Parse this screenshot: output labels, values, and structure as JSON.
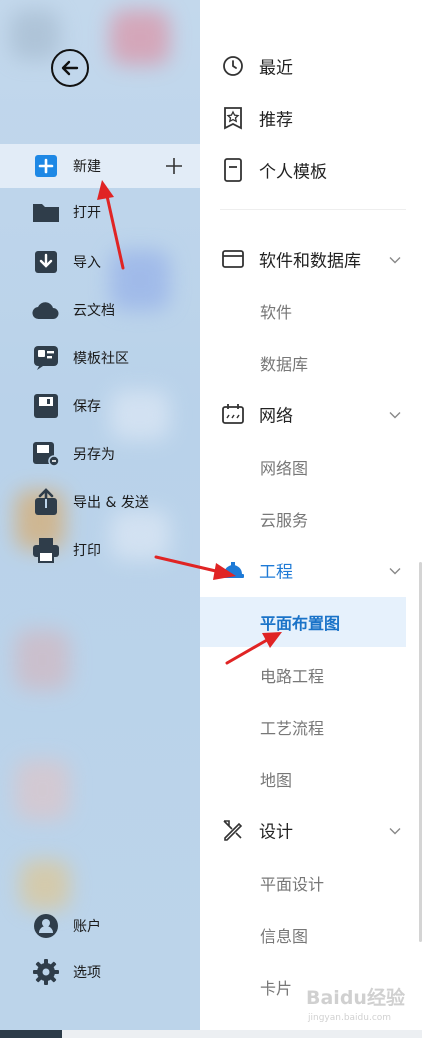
{
  "left_menu": {
    "back_label": "",
    "items": [
      {
        "id": "new",
        "label": "新建",
        "active": true
      },
      {
        "id": "open",
        "label": "打开"
      },
      {
        "id": "import",
        "label": "导入"
      },
      {
        "id": "cloud",
        "label": "云文档"
      },
      {
        "id": "templates",
        "label": "模板社区"
      },
      {
        "id": "save",
        "label": "保存"
      },
      {
        "id": "save_as",
        "label": "另存为"
      },
      {
        "id": "export",
        "label": "导出 & 发送"
      },
      {
        "id": "print",
        "label": "打印"
      }
    ],
    "bottom_items": [
      {
        "id": "account",
        "label": "账户"
      },
      {
        "id": "options",
        "label": "选项"
      }
    ]
  },
  "right_menu": {
    "top_items": [
      {
        "id": "recent",
        "label": "最近",
        "icon": "clock-icon"
      },
      {
        "id": "recommend",
        "label": "推荐",
        "icon": "star-badge-icon"
      },
      {
        "id": "personal",
        "label": "个人模板",
        "icon": "document-icon"
      }
    ],
    "categories": [
      {
        "id": "software",
        "label": "软件和数据库",
        "icon": "window-icon",
        "expanded": true,
        "subitems": [
          "软件",
          "数据库"
        ]
      },
      {
        "id": "network",
        "label": "网络",
        "icon": "network-icon",
        "expanded": true,
        "subitems": [
          "网络图",
          "云服务"
        ]
      },
      {
        "id": "engineering",
        "label": "工程",
        "icon": "hard-hat-icon",
        "expanded": true,
        "active": true,
        "subitems": [
          "平面布置图",
          "电路工程",
          "工艺流程",
          "地图"
        ],
        "active_subitem": "平面布置图"
      },
      {
        "id": "design",
        "label": "设计",
        "icon": "design-tools-icon",
        "expanded": true,
        "subitems": [
          "平面设计",
          "信息图",
          "卡片"
        ]
      }
    ]
  },
  "watermark": {
    "logo": "Baidu经验",
    "url": "jingyan.baidu.com"
  },
  "colors": {
    "accent": "#1e7ad6",
    "active_sub_bg": "#e6f1fc",
    "sidebar_bg": "#bcd4ea",
    "arrow": "#e02424"
  }
}
